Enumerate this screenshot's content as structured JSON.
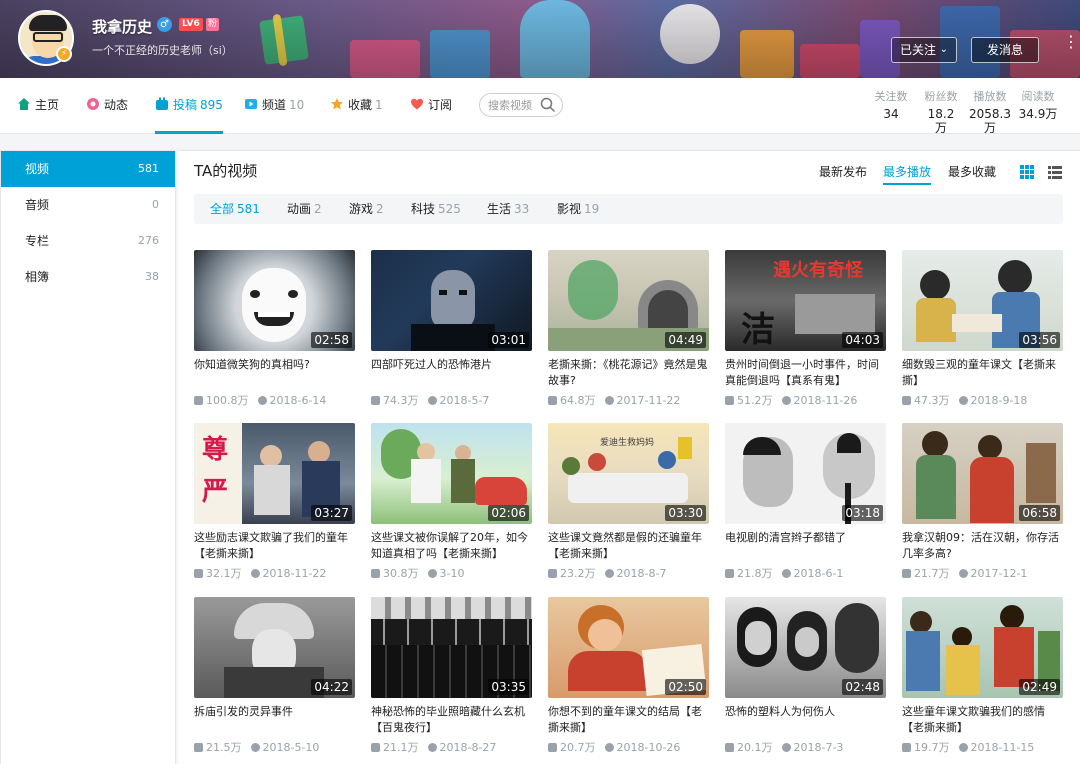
{
  "header": {
    "username": "我拿历史",
    "gender_icon": "♂",
    "level_badge": "LV6",
    "fan_badge": "粉",
    "signature": "一个不正经的历史老师（si）",
    "verify_icon": "⚡",
    "followed_label": "已关注",
    "followed_chevron": "⌄",
    "message_label": "发消息",
    "more_icon": "⋮"
  },
  "nav": {
    "items": [
      {
        "label": "主页",
        "count": "",
        "icon": "home-icon",
        "color": "#13a07e"
      },
      {
        "label": "动态",
        "count": "",
        "icon": "dynamic-icon",
        "color": "#f06292"
      },
      {
        "label": "投稿",
        "count": "895",
        "icon": "upload-icon",
        "color": "#00a1d6"
      },
      {
        "label": "频道",
        "count": "10",
        "icon": "channel-icon",
        "color": "#23ade5"
      },
      {
        "label": "收藏",
        "count": "1",
        "icon": "favorite-icon",
        "color": "#f5a623"
      },
      {
        "label": "订阅",
        "count": "",
        "icon": "subscribe-icon",
        "color": "#f25d4e"
      }
    ],
    "search_placeholder": "搜索视频"
  },
  "stats": [
    {
      "label": "关注数",
      "value": "34",
      "value2": ""
    },
    {
      "label": "粉丝数",
      "value": "18.2万",
      "value2": ""
    },
    {
      "label": "播放数",
      "value": "2058.3",
      "value2": "万"
    },
    {
      "label": "阅读数",
      "value": "34.9万",
      "value2": ""
    }
  ],
  "sidebar": {
    "items": [
      {
        "label": "视频",
        "count": "581"
      },
      {
        "label": "音频",
        "count": "0"
      },
      {
        "label": "专栏",
        "count": "276"
      },
      {
        "label": "相簿",
        "count": "38"
      }
    ]
  },
  "main": {
    "title": "TA的视频",
    "sorts": [
      "最新发布",
      "最多播放",
      "最多收藏"
    ],
    "active_sort": "最多播放"
  },
  "filters": [
    {
      "label": "全部",
      "count": "581"
    },
    {
      "label": "动画",
      "count": "2"
    },
    {
      "label": "游戏",
      "count": "2"
    },
    {
      "label": "科技",
      "count": "525"
    },
    {
      "label": "生活",
      "count": "33"
    },
    {
      "label": "影视",
      "count": "19"
    }
  ],
  "thumb_texts": {
    "v3_overlay": "遇火有奇怪",
    "v3_char": "洁",
    "v5_char1": "尊",
    "v5_char2": "严",
    "v7_caption": "爱迪生救妈妈"
  },
  "videos": [
    {
      "title": "你知道微笑狗的真相吗?",
      "duration": "02:58",
      "views": "100.8万",
      "date": "2018-6-14"
    },
    {
      "title": "四部吓死过人的恐怖港片",
      "duration": "03:01",
      "views": "74.3万",
      "date": "2018-5-7"
    },
    {
      "title": "老撕来撕：《桃花源记》竟然是鬼故事?",
      "duration": "04:49",
      "views": "64.8万",
      "date": "2017-11-22"
    },
    {
      "title": "贵州时间倒退一小时事件，时间真能倒退吗【真系有鬼】",
      "duration": "04:03",
      "views": "51.2万",
      "date": "2018-11-26"
    },
    {
      "title": "细数毁三观的童年课文【老撕来撕】",
      "duration": "03:56",
      "views": "47.3万",
      "date": "2018-9-18"
    },
    {
      "title": "这些励志课文欺骗了我们的童年【老撕来撕】",
      "duration": "03:27",
      "views": "32.1万",
      "date": "2018-11-22"
    },
    {
      "title": "这些课文被你误解了20年，如今知道真相了吗【老撕来撕】",
      "duration": "02:06",
      "views": "30.8万",
      "date": "3-10"
    },
    {
      "title": "这些课文竟然都是假的还骗童年【老撕来撕】",
      "duration": "03:30",
      "views": "23.2万",
      "date": "2018-8-7"
    },
    {
      "title": "电视剧的清宫辫子都错了",
      "duration": "03:18",
      "views": "21.8万",
      "date": "2018-6-1"
    },
    {
      "title": "我拿汉朝09：活在汉朝，你存活几率多高?",
      "duration": "06:58",
      "views": "21.7万",
      "date": "2017-12-1"
    },
    {
      "title": "拆庙引发的灵异事件",
      "duration": "04:22",
      "views": "21.5万",
      "date": "2018-5-10"
    },
    {
      "title": "神秘恐怖的毕业照暗藏什么玄机【百鬼夜行】",
      "duration": "03:35",
      "views": "21.1万",
      "date": "2018-8-27"
    },
    {
      "title": "你想不到的童年课文的结局【老撕来撕】",
      "duration": "02:50",
      "views": "20.7万",
      "date": "2018-10-26"
    },
    {
      "title": "恐怖的塑料人为何伤人",
      "duration": "02:48",
      "views": "20.1万",
      "date": "2018-7-3"
    },
    {
      "title": "这些童年课文欺骗我们的感情【老撕来撕】",
      "duration": "02:49",
      "views": "19.7万",
      "date": "2018-11-15"
    }
  ],
  "colors": {
    "accent": "#00a1d6",
    "muted": "#99a2aa"
  }
}
